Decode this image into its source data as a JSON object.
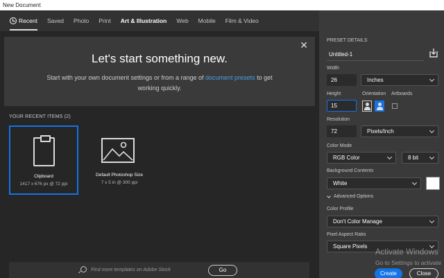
{
  "window": {
    "title": "New Document"
  },
  "tabs": [
    {
      "label": "Recent"
    },
    {
      "label": "Saved"
    },
    {
      "label": "Photo"
    },
    {
      "label": "Print"
    },
    {
      "label": "Art & Illustration"
    },
    {
      "label": "Web"
    },
    {
      "label": "Mobile"
    },
    {
      "label": "Film & Video"
    }
  ],
  "hero": {
    "title": "Let's start something new.",
    "subtitle_before": "Start with your own document settings or from a range of ",
    "subtitle_link": "document presets",
    "subtitle_after": " to get working quickly."
  },
  "recent": {
    "header": "YOUR RECENT ITEMS  (2)",
    "items": [
      {
        "name": "Clipboard",
        "info": "1417 x 676 px @ 72 ppi"
      },
      {
        "name": "Default Photoshop Size",
        "info": "7 x 5 in @ 300 ppi"
      }
    ]
  },
  "stock": {
    "placeholder": "Find more templates on Adobe Stock",
    "go_label": "Go"
  },
  "preset": {
    "header": "PRESET DETAILS",
    "name": "Untitled-1",
    "width_label": "Width",
    "width_value": "26",
    "width_unit": "Inches",
    "height_label": "Height",
    "height_value": "15",
    "orientation_label": "Orientation",
    "artboards_label": "Artboards",
    "resolution_label": "Resolution",
    "resolution_value": "72",
    "resolution_unit": "Pixels/Inch",
    "color_mode_label": "Color Mode",
    "color_mode_value": "RGB Color",
    "bit_depth": "8 bit",
    "bg_label": "Background Contents",
    "bg_value": "White",
    "bg_color": "#ffffff",
    "advanced_label": "Advanced Options",
    "profile_label": "Color Profile",
    "profile_value": "Don't Color Manage",
    "pixel_ratio_label": "Pixel Aspect Ratio",
    "pixel_ratio_value": "Square Pixels"
  },
  "actions": {
    "create": "Create",
    "close": "Close"
  },
  "watermark": {
    "line1": "Activate Windows",
    "line2": "Go to Settings to activate"
  },
  "colors": {
    "accent": "#1473e6",
    "link": "#4a9fe8"
  }
}
